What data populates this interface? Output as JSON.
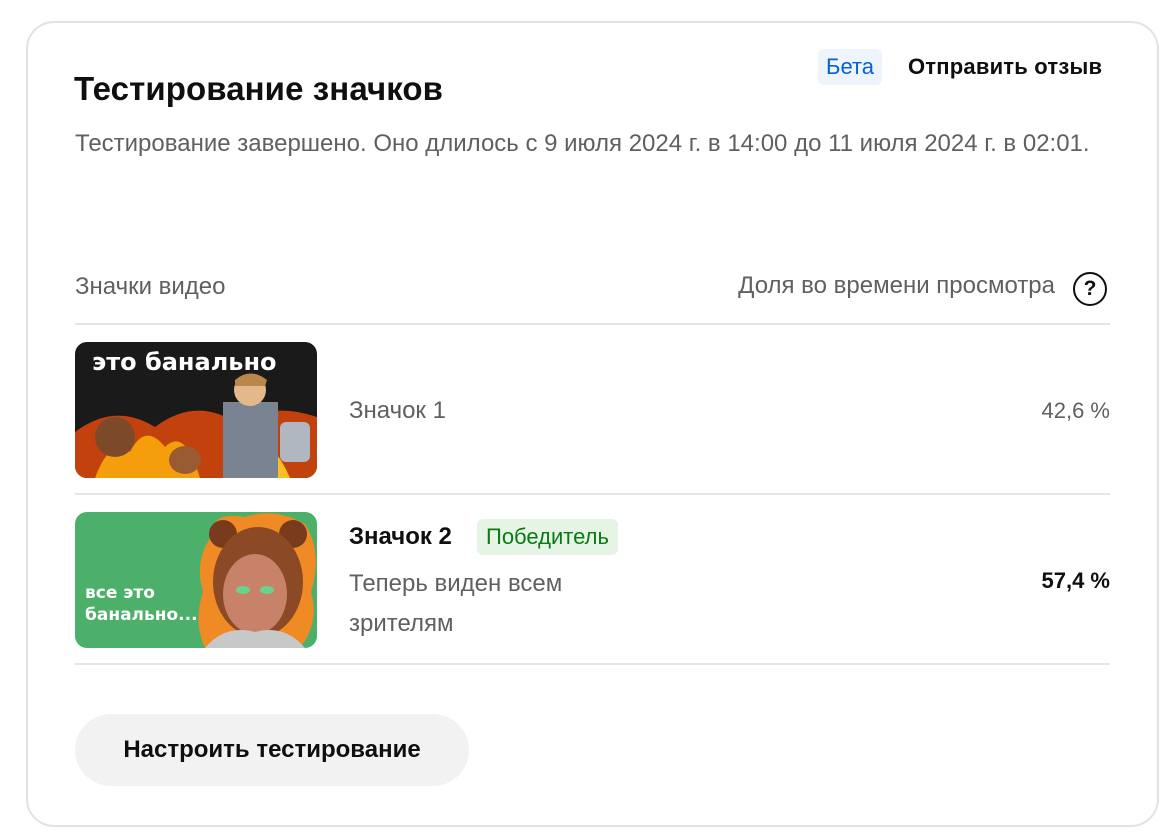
{
  "header": {
    "title": "Тестирование значков",
    "beta_badge": "Бета",
    "feedback_link": "Отправить отзыв"
  },
  "description": "Тестирование завершено. Оно длилось с 9 июля 2024 г. в 14:00 до 11 июля 2024 г. в 02:01.",
  "table": {
    "col_thumbnails": "Значки видео",
    "col_share": "Доля во времени просмотра",
    "help_icon": "?",
    "rows": [
      {
        "label": "Значок 1",
        "share": "42,6 %",
        "thumbnail_text": "это банально",
        "thumbnail_bg": "#1a1a1a"
      },
      {
        "label": "Значок 2",
        "winner_badge": "Победитель",
        "subtitle": "Теперь виден всем зрителям",
        "share": "57,4 %",
        "thumbnail_text_line1": "все это",
        "thumbnail_text_line2": "банально...",
        "thumbnail_bg": "#4caf6a"
      }
    ]
  },
  "actions": {
    "setup_button": "Настроить тестирование"
  },
  "colors": {
    "accent_blue": "#065fd4",
    "winner_green": "#0b7a16",
    "secondary_text": "#606060"
  }
}
